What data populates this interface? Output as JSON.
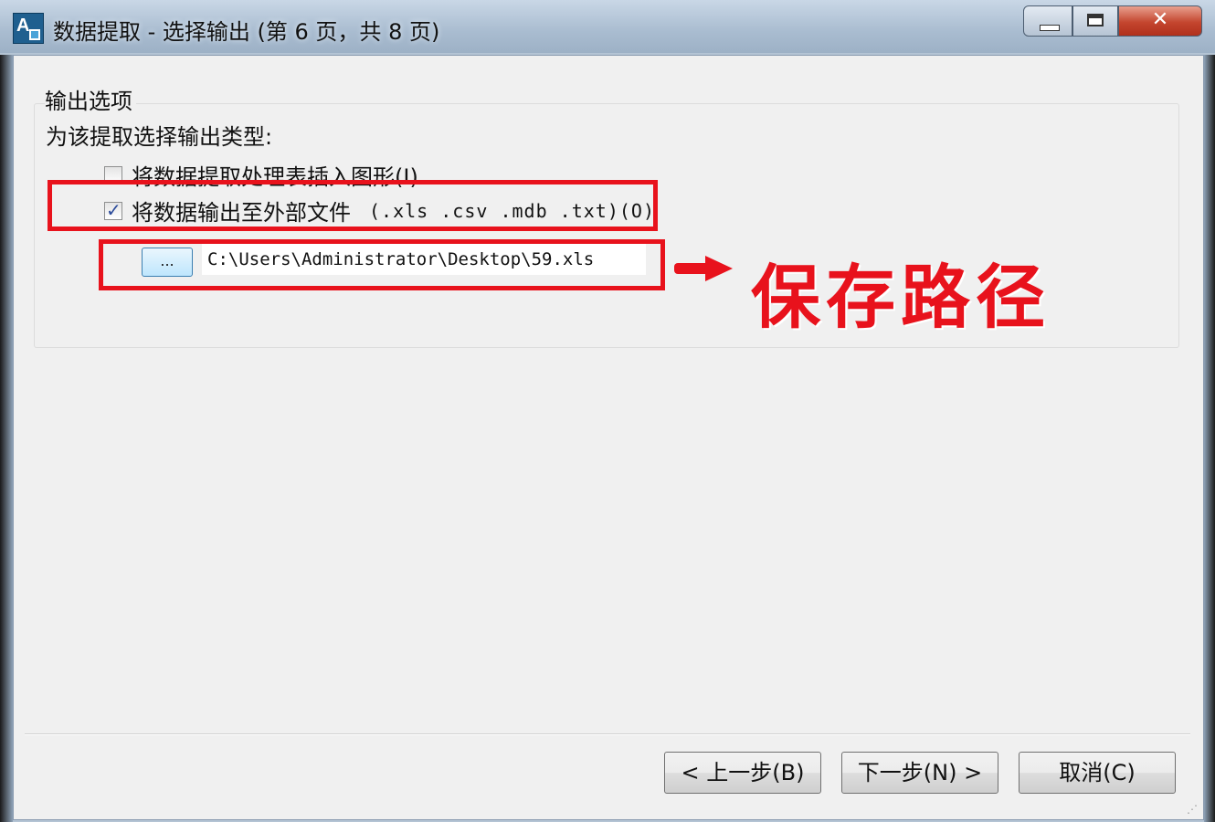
{
  "window": {
    "title": "数据提取 - 选择输出 (第 6 页，共 8 页)",
    "controls": {
      "minimize": "—",
      "maximize": "□",
      "close": "✕"
    }
  },
  "output_options": {
    "legend": "输出选项",
    "subtitle": "为该提取选择输出类型:",
    "insert_table": {
      "label": "将数据提取处理表插入图形(I)",
      "checked": false
    },
    "export_file": {
      "label": "将数据输出至外部文件",
      "formats": "(.xls .csv .mdb .txt)(O)",
      "checked": true
    },
    "browse_label": "...",
    "path_value": "C:\\Users\\Administrator\\Desktop\\59.xls"
  },
  "footer": {
    "back_label": "< 上一步(B)",
    "next_label": "下一步(N) >",
    "cancel_label": "取消(C)"
  },
  "annotation": {
    "text": "保存路径",
    "color": "#e8121c"
  }
}
